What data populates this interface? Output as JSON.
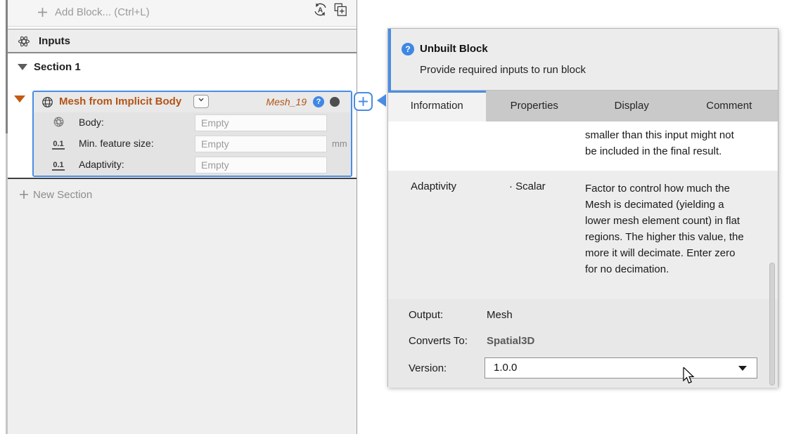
{
  "icons": {
    "help_glyph": "?",
    "autobuild_glyph": "A"
  },
  "colors": {
    "accent_blue": "#4a8de4",
    "accent_orange": "#c25a11",
    "block_title_orange": "#b35417",
    "status_circle": "#4f4f4f"
  },
  "left_panel": {
    "toolbar": {
      "add_block_label": "Add Block... (Ctrl+L)"
    },
    "inputs_header": {
      "label": "Inputs"
    },
    "section": {
      "label": "Section 1"
    },
    "block": {
      "title": "Mesh from Implicit Body",
      "instance_name": "Mesh_19",
      "scalar_icon_text": "0.1",
      "fields": [
        {
          "label": "Body:",
          "value": "Empty",
          "unit": ""
        },
        {
          "label": "Min. feature size:",
          "value": "Empty",
          "unit": "mm"
        },
        {
          "label": "Adaptivity:",
          "value": "Empty",
          "unit": ""
        }
      ]
    },
    "new_section_label": "New Section"
  },
  "info_panel": {
    "banner": {
      "title": "Unbuilt Block",
      "subtitle": "Provide required inputs to run block"
    },
    "tabs": [
      {
        "label": "Information",
        "active": true
      },
      {
        "label": "Properties",
        "active": false
      },
      {
        "label": "Display",
        "active": false
      },
      {
        "label": "Comment",
        "active": false
      }
    ],
    "table_rows": [
      {
        "name": "",
        "type": "",
        "description": "smaller than this input might not be included in the final result."
      },
      {
        "name": "Adaptivity",
        "type": "· Scalar",
        "description": "Factor to control how much the Mesh is decimated (yielding a lower mesh element count) in flat regions. The higher this value, the more it will decimate. Enter zero for no decimation."
      }
    ],
    "footer": {
      "output_label": "Output:",
      "output_value": "Mesh",
      "converts_label": "Converts To:",
      "converts_value": "Spatial3D",
      "version_label": "Version:",
      "version_value": "1.0.0"
    }
  }
}
